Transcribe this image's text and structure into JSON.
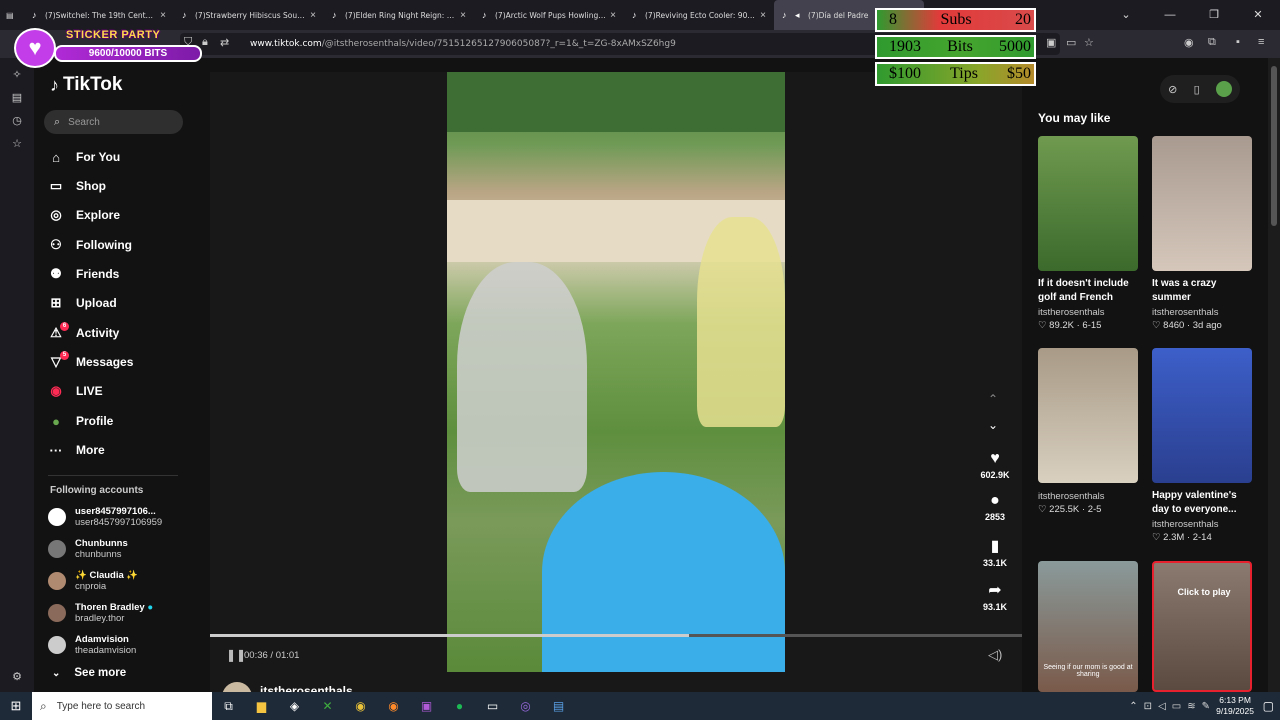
{
  "browser": {
    "tabs": [
      {
        "title": "(7)Switchel: The 19th Century Fa",
        "active": false
      },
      {
        "title": "(7)Strawberry Hibiscus Sour: A S",
        "active": false
      },
      {
        "title": "(7)Elden Ring Night Reign: Best",
        "active": false
      },
      {
        "title": "(7)Arctic Wolf Pups Howling wit",
        "active": false
      },
      {
        "title": "(7)Reviving Ecto Cooler: 90's Ni",
        "active": false
      },
      {
        "title": "(7)Día del Padre",
        "active": true
      }
    ],
    "url_host": "www.tiktok.com",
    "url_path": "/@itstherosenthals/video/7515126512790605087?_r=1&_t=ZG-8xAMxSZ6hg9"
  },
  "overlay": {
    "sticker_title": "STICKER PARTY",
    "sticker_progress": "9600/10000 BITS",
    "goals": [
      {
        "left": "8",
        "mid": "Subs",
        "right": "20"
      },
      {
        "left": "1903",
        "mid": "Bits",
        "right": "5000"
      },
      {
        "left": "$100",
        "mid": "Tips",
        "right": "$50"
      }
    ]
  },
  "nav": {
    "logo": "TikTok",
    "search_placeholder": "Search",
    "items": [
      {
        "label": "For You",
        "icon": "home-icon"
      },
      {
        "label": "Shop",
        "icon": "shop-icon"
      },
      {
        "label": "Explore",
        "icon": "compass-icon"
      },
      {
        "label": "Following",
        "icon": "following-icon"
      },
      {
        "label": "Friends",
        "icon": "friends-icon"
      },
      {
        "label": "Upload",
        "icon": "upload-icon"
      },
      {
        "label": "Activity",
        "icon": "activity-icon",
        "badge": "6"
      },
      {
        "label": "Messages",
        "icon": "messages-icon",
        "badge": "5"
      },
      {
        "label": "LIVE",
        "icon": "live-icon"
      },
      {
        "label": "Profile",
        "icon": "profile-icon"
      },
      {
        "label": "More",
        "icon": "more-icon"
      }
    ],
    "following_header": "Following accounts",
    "accounts": [
      {
        "display": "user8457997106...",
        "handle": "user8457997106959"
      },
      {
        "display": "Chunbunns",
        "handle": "chunbunns"
      },
      {
        "display": "✨ Claudia ✨",
        "handle": "cnproia"
      },
      {
        "display": "Thoren Bradley",
        "handle": "bradley.thor"
      },
      {
        "display": "Adamvision",
        "handle": "theadamvision"
      }
    ],
    "see_more": "See more"
  },
  "video": {
    "time": "00:36 / 01:01",
    "progress_fraction": 0.59,
    "author": "itstherosenthals",
    "likes": "602.9K",
    "comments": "2853",
    "saves": "33.1K",
    "shares": "93.1K"
  },
  "recommend": {
    "title": "You may like",
    "cards": [
      {
        "caption": "If it doesn't include golf and French frie...",
        "author": "itstherosenthals",
        "meta": "♡ 89.2K · 6-15",
        "overlay": ""
      },
      {
        "caption": "It was a crazy summer",
        "author": "itstherosenthals",
        "meta": "♡ 8460 · 3d ago",
        "overlay": ""
      },
      {
        "caption": "",
        "author": "itstherosenthals",
        "meta": "♡ 225.5K · 2-5",
        "overlay": ""
      },
      {
        "caption": "Happy valentine's day to everyone...",
        "author": "itstherosenthals",
        "meta": "♡ 2.3M · 2-14",
        "overlay": ""
      },
      {
        "caption": "",
        "author": "",
        "meta": "",
        "overlay": "Seeing if our mom is good at sharing"
      },
      {
        "caption": "",
        "author": "",
        "meta": "",
        "overlay": "Click to play"
      }
    ]
  },
  "taskbar": {
    "search_placeholder": "Type here to search",
    "time": "6:13 PM",
    "date": "9/19/2025"
  }
}
